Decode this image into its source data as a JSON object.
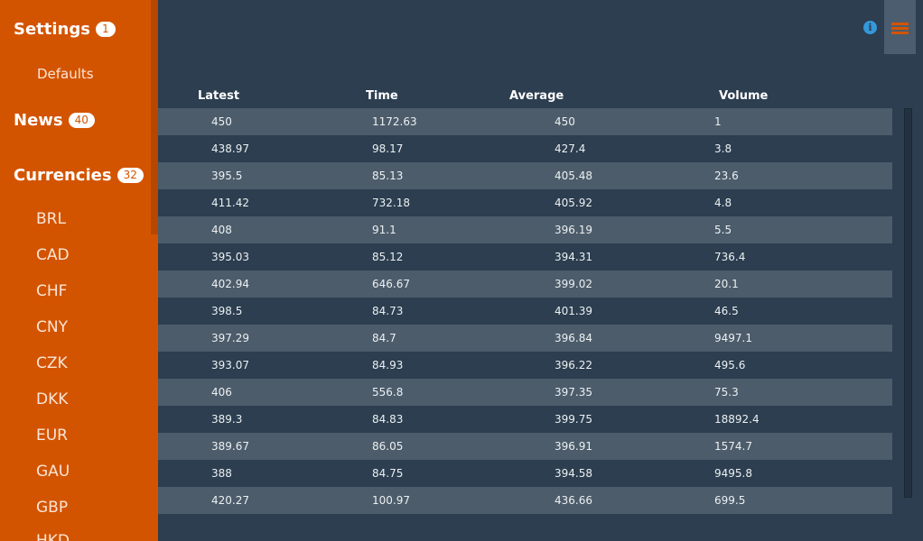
{
  "sidebar": {
    "settings": {
      "label": "Settings",
      "count": "1",
      "items": [
        "Defaults"
      ]
    },
    "news": {
      "label": "News",
      "count": "40"
    },
    "currencies": {
      "label": "Currencies",
      "count": "32",
      "items": [
        "BRL",
        "CAD",
        "CHF",
        "CNY",
        "CZK",
        "DKK",
        "EUR",
        "GAU",
        "GBP",
        "HKD"
      ]
    }
  },
  "header": {
    "info_icon": "info-icon",
    "menu_icon": "hamburger-menu-icon"
  },
  "table": {
    "columns": [
      "Latest",
      "Time",
      "Average",
      "Volume"
    ],
    "rows": [
      [
        "450",
        "1172.63",
        "450",
        "1"
      ],
      [
        "438.97",
        "98.17",
        "427.4",
        "3.8"
      ],
      [
        "395.5",
        "85.13",
        "405.48",
        "23.6"
      ],
      [
        "411.42",
        "732.18",
        "405.92",
        "4.8"
      ],
      [
        "408",
        "91.1",
        "396.19",
        "5.5"
      ],
      [
        "395.03",
        "85.12",
        "394.31",
        "736.4"
      ],
      [
        "402.94",
        "646.67",
        "399.02",
        "20.1"
      ],
      [
        "398.5",
        "84.73",
        "401.39",
        "46.5"
      ],
      [
        "397.29",
        "84.7",
        "396.84",
        "9497.1"
      ],
      [
        "393.07",
        "84.93",
        "396.22",
        "495.6"
      ],
      [
        "406",
        "556.8",
        "397.35",
        "75.3"
      ],
      [
        "389.3",
        "84.83",
        "399.75",
        "18892.4"
      ],
      [
        "389.67",
        "86.05",
        "396.91",
        "1574.7"
      ],
      [
        "388",
        "84.75",
        "394.58",
        "9495.8"
      ],
      [
        "420.27",
        "100.97",
        "436.66",
        "699.5"
      ]
    ]
  },
  "colors": {
    "sidebar": "#d35400",
    "background": "#2c3e50",
    "row_alt": "#4c5c6b",
    "info": "#3498db"
  }
}
